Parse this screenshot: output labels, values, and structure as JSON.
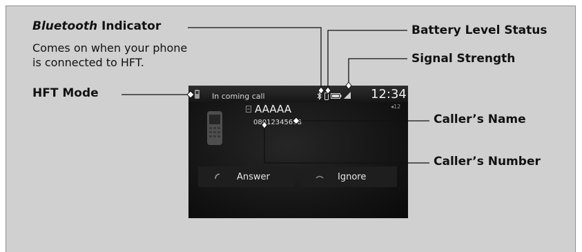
{
  "callouts": {
    "bluetooth_italic": "Bluetooth",
    "bluetooth_rest": " Indicator",
    "bluetooth_desc_line1": "Comes on when your phone",
    "bluetooth_desc_line2": "is connected to HFT.",
    "battery": "Battery Level Status",
    "signal": "Signal Strength",
    "hft_mode": "HFT Mode",
    "caller_name": "Caller’s Name",
    "caller_number": "Caller’s Number"
  },
  "screen": {
    "status_title": "In coming call",
    "clock": "12:34",
    "volume": "◂12",
    "caller_name": "AAAAA",
    "caller_number": "08012345678",
    "answer_label": "Answer",
    "ignore_label": "Ignore"
  },
  "colors": {
    "panel_bg": "#d0d0d0",
    "screen_bg": "#141414",
    "screen_text": "#e6e6e6"
  }
}
